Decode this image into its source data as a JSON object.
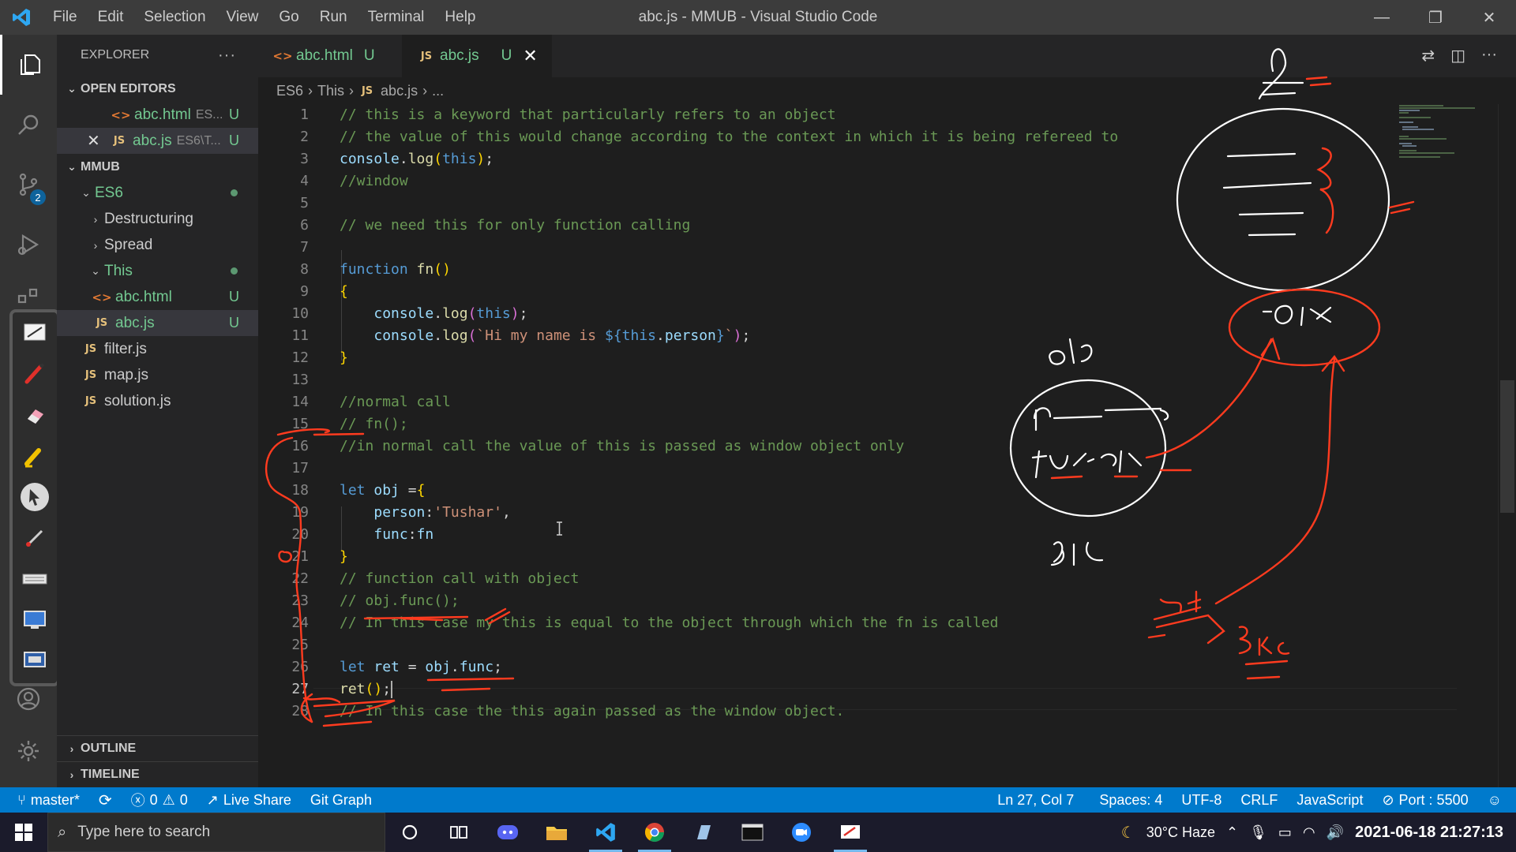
{
  "titlebar": {
    "menu": [
      "File",
      "Edit",
      "Selection",
      "View",
      "Go",
      "Run",
      "Terminal",
      "Help"
    ],
    "title": "abc.js - MMUB - Visual Studio Code",
    "minimize": "—",
    "restore": "❐",
    "close": "✕"
  },
  "activity": {
    "scm_badge": "2"
  },
  "sidebar": {
    "title": "EXPLORER",
    "more": "···",
    "open_editors": {
      "label": "OPEN EDITORS",
      "items": [
        {
          "name": "abc.html",
          "path": "ES...",
          "status": "U"
        },
        {
          "name": "abc.js",
          "path": "ES6\\T...",
          "status": "U"
        }
      ]
    },
    "workspace": {
      "label": "MMUB",
      "es6": "ES6",
      "destructuring": "Destructuring",
      "spread": "Spread",
      "this": "This",
      "this_files": [
        {
          "name": "abc.html",
          "status": "U"
        },
        {
          "name": "abc.js",
          "status": "U"
        }
      ],
      "root_files": [
        "filter.js",
        "map.js",
        "solution.js"
      ]
    },
    "outline": "OUTLINE",
    "timeline": "TIMELINE"
  },
  "tabs": [
    {
      "label": "abc.html",
      "status": "U"
    },
    {
      "label": "abc.js",
      "status": "U"
    }
  ],
  "breadcrumb": {
    "parts": [
      "ES6",
      "This",
      "abc.js",
      "..."
    ]
  },
  "editor": {
    "lines": [
      "1",
      "2",
      "3",
      "4",
      "5",
      "6",
      "7",
      "8",
      "9",
      "10",
      "11",
      "12",
      "13",
      "14",
      "15",
      "16",
      "17",
      "18",
      "19",
      "20",
      "21",
      "22",
      "23",
      "24",
      "25",
      "26",
      "27",
      "28"
    ],
    "current_line": 27
  },
  "statusbar": {
    "branch": "master*",
    "errors": "0",
    "warnings": "0",
    "live_share": "Live Share",
    "git_graph": "Git Graph",
    "position": "Ln 27, Col 7",
    "spaces": "Spaces: 4",
    "encoding": "UTF-8",
    "eol": "CRLF",
    "language": "JavaScript",
    "port": "Port : 5500"
  },
  "taskbar": {
    "search_placeholder": "Type here to search",
    "weather": "30°C  Haze",
    "datetime": "2021-06-18 21:27:13"
  },
  "colors": {
    "accent": "#007acc",
    "annotation_red": "#ff3b1f",
    "annotation_white": "#ffffff"
  }
}
